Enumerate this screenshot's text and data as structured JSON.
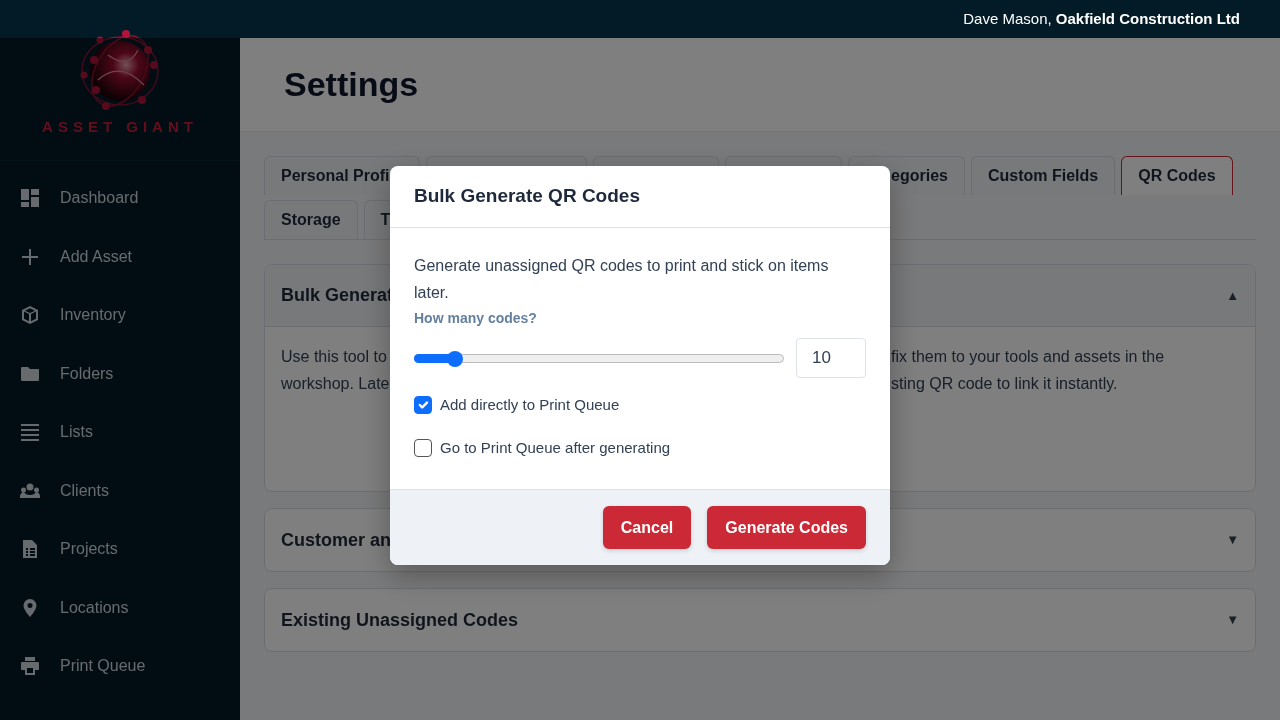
{
  "topbar": {
    "user": "Dave Mason,",
    "company": "Oakfield Construction Ltd"
  },
  "sidebar": {
    "logo_text": "ASSET GIANT",
    "items": [
      {
        "label": "Dashboard"
      },
      {
        "label": "Add Asset"
      },
      {
        "label": "Inventory"
      },
      {
        "label": "Folders"
      },
      {
        "label": "Lists"
      },
      {
        "label": "Clients"
      },
      {
        "label": "Projects"
      },
      {
        "label": "Locations"
      },
      {
        "label": "Print Queue"
      }
    ]
  },
  "page_title": "Settings",
  "tabs": [
    {
      "label": "Personal Profi",
      "selected": false
    },
    {
      "selected": false
    },
    {
      "selected": false
    },
    {
      "selected": false
    },
    {
      "label": "egories",
      "selected": false
    },
    {
      "label": "Custom Fields",
      "selected": false
    },
    {
      "label": "QR Codes",
      "selected": true
    },
    {
      "label": "Storage",
      "selected": false
    },
    {
      "label": "T",
      "selected": false
    }
  ],
  "accordion": [
    {
      "title": "Bulk Generat",
      "indicator": "▲",
      "expanded": true,
      "body_left": [
        "Use this tool to",
        "workshop. Late"
      ],
      "body_right": [
        "fix them to your tools and assets in the",
        "sting QR code to link it instantly."
      ]
    },
    {
      "title": "Customer an",
      "indicator": "▼",
      "expanded": false
    },
    {
      "title": "Existing Unassigned Codes",
      "indicator": "▼",
      "expanded": false
    }
  ],
  "modal": {
    "title": "Bulk Generate QR Codes",
    "description": "Generate unassigned QR codes to print and stick on items later.",
    "count_label": "How many codes?",
    "count_slider": {
      "level": 0.108
    },
    "count_value": "10",
    "options": [
      {
        "label": "Add directly to Print Queue",
        "checked": true
      },
      {
        "label": "Go to Print Queue after generating",
        "checked": false
      }
    ],
    "buttons": [
      "Cancel",
      "Generate Codes"
    ]
  }
}
